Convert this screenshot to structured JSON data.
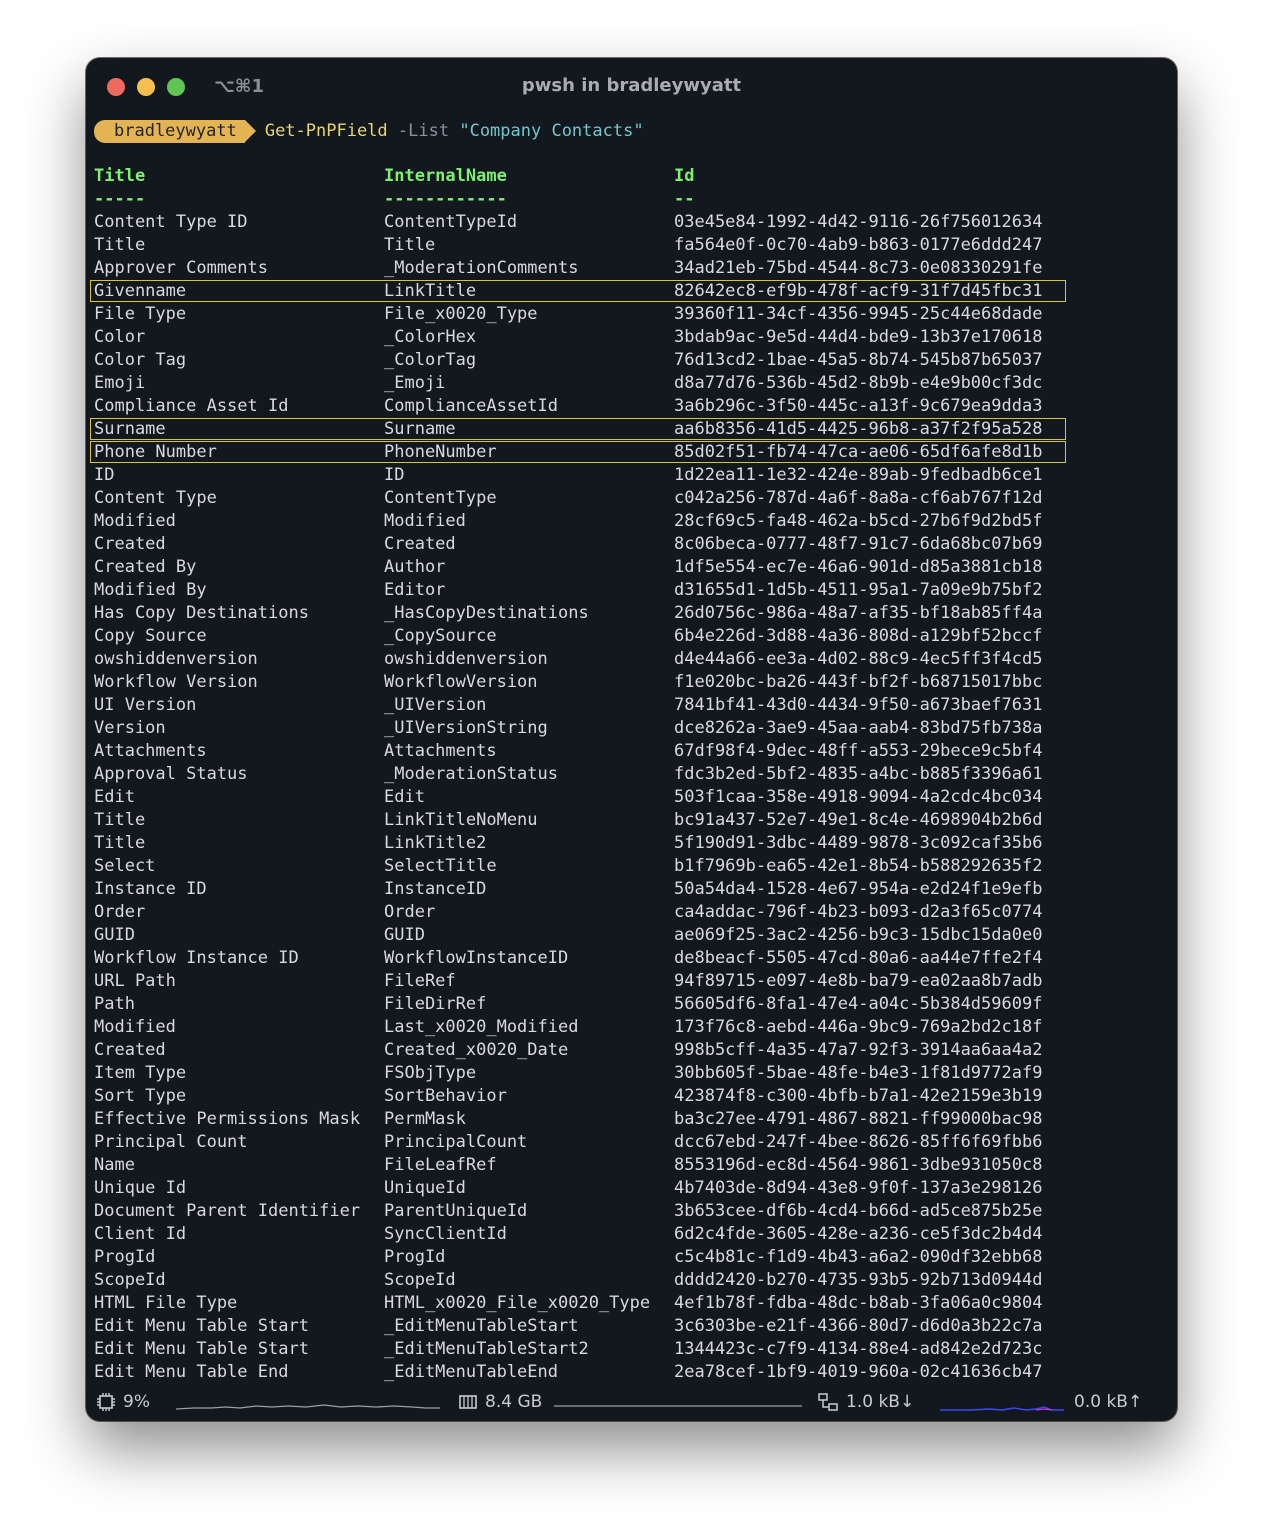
{
  "window": {
    "title": "pwsh in bradleywyatt",
    "shortcut": "⌥⌘1"
  },
  "prompt": {
    "user": "bradleywyatt",
    "command": "Get-PnPField",
    "param": "-List",
    "value": "\"Company Contacts\""
  },
  "table": {
    "headers": [
      "Title",
      "InternalName",
      "Id"
    ],
    "underlines": [
      "-----",
      "------------",
      "--"
    ],
    "highlighted_rows": [
      3,
      9,
      10
    ],
    "rows": [
      [
        "Content Type ID",
        "ContentTypeId",
        "03e45e84-1992-4d42-9116-26f756012634"
      ],
      [
        "Title",
        "Title",
        "fa564e0f-0c70-4ab9-b863-0177e6ddd247"
      ],
      [
        "Approver Comments",
        "_ModerationComments",
        "34ad21eb-75bd-4544-8c73-0e08330291fe"
      ],
      [
        "Givenname",
        "LinkTitle",
        "82642ec8-ef9b-478f-acf9-31f7d45fbc31"
      ],
      [
        "File Type",
        "File_x0020_Type",
        "39360f11-34cf-4356-9945-25c44e68dade"
      ],
      [
        "Color",
        "_ColorHex",
        "3bdab9ac-9e5d-44d4-bde9-13b37e170618"
      ],
      [
        "Color Tag",
        "_ColorTag",
        "76d13cd2-1bae-45a5-8b74-545b87b65037"
      ],
      [
        "Emoji",
        "_Emoji",
        "d8a77d76-536b-45d2-8b9b-e4e9b00cf3dc"
      ],
      [
        "Compliance Asset Id",
        "ComplianceAssetId",
        "3a6b296c-3f50-445c-a13f-9c679ea9dda3"
      ],
      [
        "Surname",
        "Surname",
        "aa6b8356-41d5-4425-96b8-a37f2f95a528"
      ],
      [
        "Phone Number",
        "PhoneNumber",
        "85d02f51-fb74-47ca-ae06-65df6afe8d1b"
      ],
      [
        "ID",
        "ID",
        "1d22ea11-1e32-424e-89ab-9fedbadb6ce1"
      ],
      [
        "Content Type",
        "ContentType",
        "c042a256-787d-4a6f-8a8a-cf6ab767f12d"
      ],
      [
        "Modified",
        "Modified",
        "28cf69c5-fa48-462a-b5cd-27b6f9d2bd5f"
      ],
      [
        "Created",
        "Created",
        "8c06beca-0777-48f7-91c7-6da68bc07b69"
      ],
      [
        "Created By",
        "Author",
        "1df5e554-ec7e-46a6-901d-d85a3881cb18"
      ],
      [
        "Modified By",
        "Editor",
        "d31655d1-1d5b-4511-95a1-7a09e9b75bf2"
      ],
      [
        "Has Copy Destinations",
        "_HasCopyDestinations",
        "26d0756c-986a-48a7-af35-bf18ab85ff4a"
      ],
      [
        "Copy Source",
        "_CopySource",
        "6b4e226d-3d88-4a36-808d-a129bf52bccf"
      ],
      [
        "owshiddenversion",
        "owshiddenversion",
        "d4e44a66-ee3a-4d02-88c9-4ec5ff3f4cd5"
      ],
      [
        "Workflow Version",
        "WorkflowVersion",
        "f1e020bc-ba26-443f-bf2f-b68715017bbc"
      ],
      [
        "UI Version",
        "_UIVersion",
        "7841bf41-43d0-4434-9f50-a673baef7631"
      ],
      [
        "Version",
        "_UIVersionString",
        "dce8262a-3ae9-45aa-aab4-83bd75fb738a"
      ],
      [
        "Attachments",
        "Attachments",
        "67df98f4-9dec-48ff-a553-29bece9c5bf4"
      ],
      [
        "Approval Status",
        "_ModerationStatus",
        "fdc3b2ed-5bf2-4835-a4bc-b885f3396a61"
      ],
      [
        "Edit",
        "Edit",
        "503f1caa-358e-4918-9094-4a2cdc4bc034"
      ],
      [
        "Title",
        "LinkTitleNoMenu",
        "bc91a437-52e7-49e1-8c4e-4698904b2b6d"
      ],
      [
        "Title",
        "LinkTitle2",
        "5f190d91-3dbc-4489-9878-3c092caf35b6"
      ],
      [
        "Select",
        "SelectTitle",
        "b1f7969b-ea65-42e1-8b54-b588292635f2"
      ],
      [
        "Instance ID",
        "InstanceID",
        "50a54da4-1528-4e67-954a-e2d24f1e9efb"
      ],
      [
        "Order",
        "Order",
        "ca4addac-796f-4b23-b093-d2a3f65c0774"
      ],
      [
        "GUID",
        "GUID",
        "ae069f25-3ac2-4256-b9c3-15dbc15da0e0"
      ],
      [
        "Workflow Instance ID",
        "WorkflowInstanceID",
        "de8beacf-5505-47cd-80a6-aa44e7ffe2f4"
      ],
      [
        "URL Path",
        "FileRef",
        "94f89715-e097-4e8b-ba79-ea02aa8b7adb"
      ],
      [
        "Path",
        "FileDirRef",
        "56605df6-8fa1-47e4-a04c-5b384d59609f"
      ],
      [
        "Modified",
        "Last_x0020_Modified",
        "173f76c8-aebd-446a-9bc9-769a2bd2c18f"
      ],
      [
        "Created",
        "Created_x0020_Date",
        "998b5cff-4a35-47a7-92f3-3914aa6aa4a2"
      ],
      [
        "Item Type",
        "FSObjType",
        "30bb605f-5bae-48fe-b4e3-1f81d9772af9"
      ],
      [
        "Sort Type",
        "SortBehavior",
        "423874f8-c300-4bfb-b7a1-42e2159e3b19"
      ],
      [
        "Effective Permissions Mask",
        "PermMask",
        "ba3c27ee-4791-4867-8821-ff99000bac98"
      ],
      [
        "Principal Count",
        "PrincipalCount",
        "dcc67ebd-247f-4bee-8626-85ff6f69fbb6"
      ],
      [
        "Name",
        "FileLeafRef",
        "8553196d-ec8d-4564-9861-3dbe931050c8"
      ],
      [
        "Unique Id",
        "UniqueId",
        "4b7403de-8d94-43e8-9f0f-137a3e298126"
      ],
      [
        "Document Parent Identifier",
        "ParentUniqueId",
        "3b653cee-df6b-4cd4-b66d-ad5ce875b25e"
      ],
      [
        "Client Id",
        "SyncClientId",
        "6d2c4fde-3605-428e-a236-ce5f3dc2b4d4"
      ],
      [
        "ProgId",
        "ProgId",
        "c5c4b81c-f1d9-4b43-a6a2-090df32ebb68"
      ],
      [
        "ScopeId",
        "ScopeId",
        "dddd2420-b270-4735-93b5-92b713d0944d"
      ],
      [
        "HTML File Type",
        "HTML_x0020_File_x0020_Type",
        "4ef1b78f-fdba-48dc-b8ab-3fa06a0c9804"
      ],
      [
        "Edit Menu Table Start",
        "_EditMenuTableStart",
        "3c6303be-e21f-4366-80d7-d6d0a3b22c7a"
      ],
      [
        "Edit Menu Table Start",
        "_EditMenuTableStart2",
        "1344423c-c7f9-4134-88e4-ad842e2d723c"
      ],
      [
        "Edit Menu Table End",
        "_EditMenuTableEnd",
        "2ea78cef-1bf9-4019-960a-02c41636cb47"
      ]
    ]
  },
  "statusbar": {
    "cpu": "9%",
    "memory": "8.4 GB",
    "net_down": "1.0 kB↓",
    "net_up": "0.0 kB↑",
    "icons": [
      "cpu-icon",
      "memory-icon",
      "network-icon"
    ]
  },
  "colors": {
    "background": "#13181e",
    "header": "#7ef06f",
    "highlight_box": "#d8c631",
    "prompt_pill": "#e4b454",
    "command": "#e7d66b",
    "string": "#6fc7cf",
    "text": "#d7dade"
  }
}
